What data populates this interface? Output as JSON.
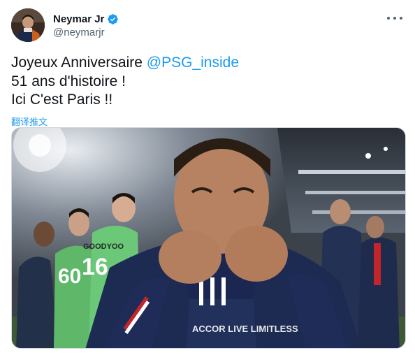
{
  "author": {
    "display_name": "Neymar Jr",
    "handle": "@neymarjr",
    "verified": true,
    "avatar_icon": "profile-photo"
  },
  "tweet": {
    "line1_text": "Joyeux Anniversaire ",
    "line1_mention": "@PSG_inside",
    "line2": "51 ans d'histoire !",
    "line3": "Ici C'est Paris !!"
  },
  "translate_label": "翻译推文",
  "media": {
    "kind": "photo",
    "jersey_numbers": [
      "60",
      "16"
    ],
    "jersey_text": "GOODYOO",
    "shirt_sponsor": "ACCOR LIVE LIMITLESS"
  },
  "colors": {
    "accent": "#1d9bf0",
    "text": "#0f1419",
    "secondary": "#536471"
  },
  "icons": {
    "verified": "verified-badge-icon",
    "more": "more-dots-icon"
  }
}
